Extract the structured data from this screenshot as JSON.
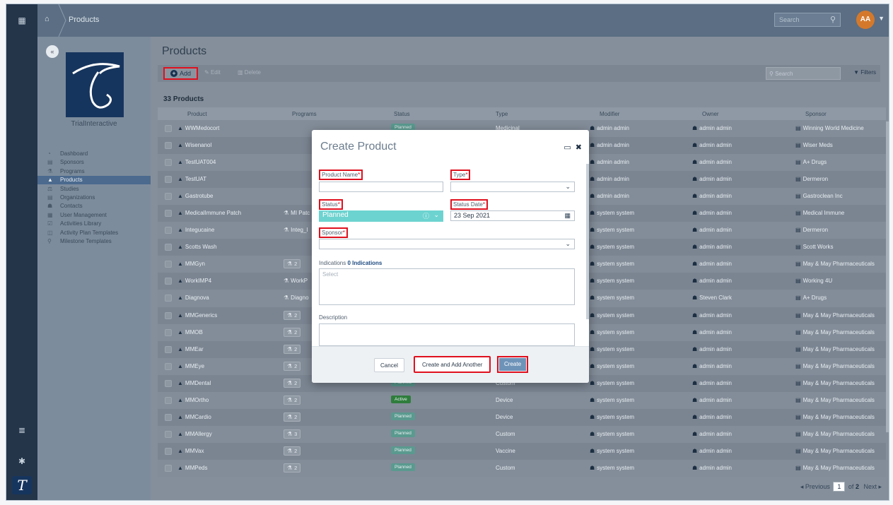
{
  "topbar": {
    "breadcrumb": "Products",
    "search_placeholder": "Search",
    "avatar_initials": "AA"
  },
  "sidebar": {
    "collapse_label": "«",
    "org_name": "TrialInteractive",
    "items": [
      {
        "label": "Dashboard",
        "icon": "dashboard-icon"
      },
      {
        "label": "Sponsors",
        "icon": "building-icon"
      },
      {
        "label": "Programs",
        "icon": "flask-icon"
      },
      {
        "label": "Products",
        "icon": "product-icon",
        "active": true
      },
      {
        "label": "Studies",
        "icon": "study-icon"
      },
      {
        "label": "Organizations",
        "icon": "organization-icon"
      },
      {
        "label": "Contacts",
        "icon": "contacts-icon"
      },
      {
        "label": "User Management",
        "icon": "user-management-icon"
      },
      {
        "label": "Activities Library",
        "icon": "calendar-check-icon"
      },
      {
        "label": "Activity Plan Templates",
        "icon": "template-icon"
      },
      {
        "label": "Milestone Templates",
        "icon": "pin-icon"
      }
    ]
  },
  "page": {
    "title": "Products",
    "count_label": "33 Products"
  },
  "toolbar": {
    "add_label": "Add",
    "edit_label": "Edit",
    "delete_label": "Delete",
    "search_placeholder": "Search",
    "filters_label": "Filters"
  },
  "table": {
    "columns": [
      "Product",
      "Programs",
      "Status",
      "Type",
      "Modifier",
      "Owner",
      "Sponsor"
    ],
    "rows": [
      {
        "product": "WWMedocort",
        "programs": "",
        "status": "Planned",
        "type": "Medicinal",
        "modifier": "admin admin",
        "owner": "admin admin",
        "sponsor": "Winning World Medicine"
      },
      {
        "product": "Wisenanol",
        "programs": "",
        "status": "",
        "type": "",
        "modifier": "admin admin",
        "owner": "admin admin",
        "sponsor": "Wiser Meds"
      },
      {
        "product": "TestUAT004",
        "programs": "",
        "status": "",
        "type": "",
        "modifier": "admin admin",
        "owner": "admin admin",
        "sponsor": "A+ Drugs"
      },
      {
        "product": "TestUAT",
        "programs": "",
        "status": "",
        "type": "",
        "modifier": "admin admin",
        "owner": "admin admin",
        "sponsor": "Dermeron"
      },
      {
        "product": "Gastrotube",
        "programs": "",
        "status": "",
        "type": "",
        "modifier": "admin admin",
        "owner": "admin admin",
        "sponsor": "Gastroclean Inc"
      },
      {
        "product": "MedicalImmune Patch",
        "programs": "MI Patc",
        "status": "",
        "type": "",
        "modifier": "system system",
        "owner": "admin admin",
        "sponsor": "Medical Immune"
      },
      {
        "product": "Integucaine",
        "programs": "Integ_I",
        "status": "",
        "type": "",
        "modifier": "system system",
        "owner": "admin admin",
        "sponsor": "Dermeron"
      },
      {
        "product": "Scotts Wash",
        "programs": "",
        "status": "",
        "type": "",
        "modifier": "system system",
        "owner": "admin admin",
        "sponsor": "Scott Works"
      },
      {
        "product": "MMGyn",
        "programs": "2",
        "status": "",
        "type": "",
        "modifier": "system system",
        "owner": "admin admin",
        "sponsor": "May & May Pharmaceuticals"
      },
      {
        "product": "WorkIMP4",
        "programs": "WorkP",
        "status": "",
        "type": "",
        "modifier": "system system",
        "owner": "admin admin",
        "sponsor": "Working 4U"
      },
      {
        "product": "Diagnova",
        "programs": "Diagno",
        "status": "",
        "type": "",
        "modifier": "system system",
        "owner": "Steven Clark",
        "sponsor": "A+ Drugs"
      },
      {
        "product": "MMGenerics",
        "programs": "2",
        "status": "",
        "type": "",
        "modifier": "system system",
        "owner": "admin admin",
        "sponsor": "May & May Pharmaceuticals"
      },
      {
        "product": "MMOB",
        "programs": "2",
        "status": "",
        "type": "",
        "modifier": "system system",
        "owner": "admin admin",
        "sponsor": "May & May Pharmaceuticals"
      },
      {
        "product": "MMEar",
        "programs": "2",
        "status": "",
        "type": "",
        "modifier": "system system",
        "owner": "admin admin",
        "sponsor": "May & May Pharmaceuticals"
      },
      {
        "product": "MMEye",
        "programs": "2",
        "status": "",
        "type": "",
        "modifier": "system system",
        "owner": "admin admin",
        "sponsor": "May & May Pharmaceuticals"
      },
      {
        "product": "MMDental",
        "programs": "2",
        "status": "Planned",
        "type": "Custom",
        "modifier": "system system",
        "owner": "admin admin",
        "sponsor": "May & May Pharmaceuticals"
      },
      {
        "product": "MMOrtho",
        "programs": "2",
        "status": "Active",
        "type": "Device",
        "modifier": "system system",
        "owner": "admin admin",
        "sponsor": "May & May Pharmaceuticals"
      },
      {
        "product": "MMCardio",
        "programs": "2",
        "status": "Planned",
        "type": "Device",
        "modifier": "system system",
        "owner": "admin admin",
        "sponsor": "May & May Pharmaceuticals"
      },
      {
        "product": "MMAllergy",
        "programs": "3",
        "status": "Planned",
        "type": "Custom",
        "modifier": "system system",
        "owner": "admin admin",
        "sponsor": "May & May Pharmaceuticals"
      },
      {
        "product": "MMVax",
        "programs": "2",
        "status": "Planned",
        "type": "Vaccine",
        "modifier": "system system",
        "owner": "admin admin",
        "sponsor": "May & May Pharmaceuticals"
      },
      {
        "product": "MMPeds",
        "programs": "2",
        "status": "Planned",
        "type": "Custom",
        "modifier": "system system",
        "owner": "admin admin",
        "sponsor": "May & May Pharmaceuticals"
      }
    ]
  },
  "pager": {
    "prev_label": "◂ Previous",
    "current_page": "1",
    "of_label": "of",
    "total_pages": "2",
    "next_label": "Next ▸"
  },
  "modal": {
    "title": "Create Product",
    "product_name_label": "Product Name",
    "type_label": "Type",
    "status_label": "Status",
    "status_value": "Planned",
    "status_date_label": "Status Date",
    "status_date_value": "23 Sep 2021",
    "sponsor_label": "Sponsor",
    "required_mark": "*",
    "indications_label": "Indications",
    "indications_count": "0 Indications",
    "indications_placeholder": "Select",
    "description_label": "Description",
    "cancel_label": "Cancel",
    "create_another_label": "Create and Add Another",
    "create_label": "Create"
  },
  "colors": {
    "accent_red": "#e0101e",
    "status_teal": "#6dd3d0",
    "planned_pill": "#5a9a8f",
    "active_pill": "#2e7d3c",
    "create_button": "#6e93b9",
    "rail": "#24354a"
  }
}
